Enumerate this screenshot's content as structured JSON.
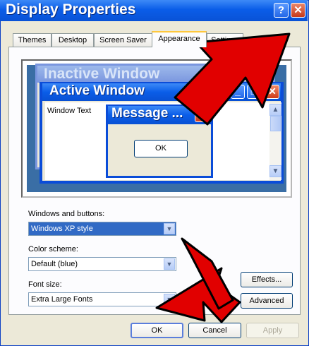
{
  "window": {
    "title": "Display Properties",
    "help_glyph": "?",
    "close_glyph": "✕"
  },
  "tabs": [
    {
      "label": "Themes",
      "selected": false
    },
    {
      "label": "Desktop",
      "selected": false
    },
    {
      "label": "Screen Saver",
      "selected": false
    },
    {
      "label": "Appearance",
      "selected": true
    },
    {
      "label": "Settings",
      "selected": false
    }
  ],
  "preview": {
    "inactive_title": "Inactive Window",
    "active_title": "Active Window",
    "window_text": "Window Text",
    "message_title": "Message ...",
    "message_ok": "OK",
    "minimize_glyph": "_",
    "maximize_glyph": "□",
    "close_glyph": "✕",
    "scroll_up_glyph": "▲",
    "scroll_down_glyph": "▼"
  },
  "windows_and_buttons": {
    "label": "Windows and buttons:",
    "value": "Windows XP style"
  },
  "color_scheme": {
    "label": "Color scheme:",
    "value": "Default (blue)"
  },
  "font_size": {
    "label": "Font size:",
    "value": "Extra Large Fonts"
  },
  "buttons": {
    "effects": "Effects...",
    "advanced": "Advanced",
    "ok": "OK",
    "cancel": "Cancel",
    "apply": "Apply"
  },
  "combo_arrow_glyph": "▼",
  "colors": {
    "title_blue": "#0a5de8",
    "selection_blue": "#316ac5",
    "annotation_red": "#e10000"
  }
}
